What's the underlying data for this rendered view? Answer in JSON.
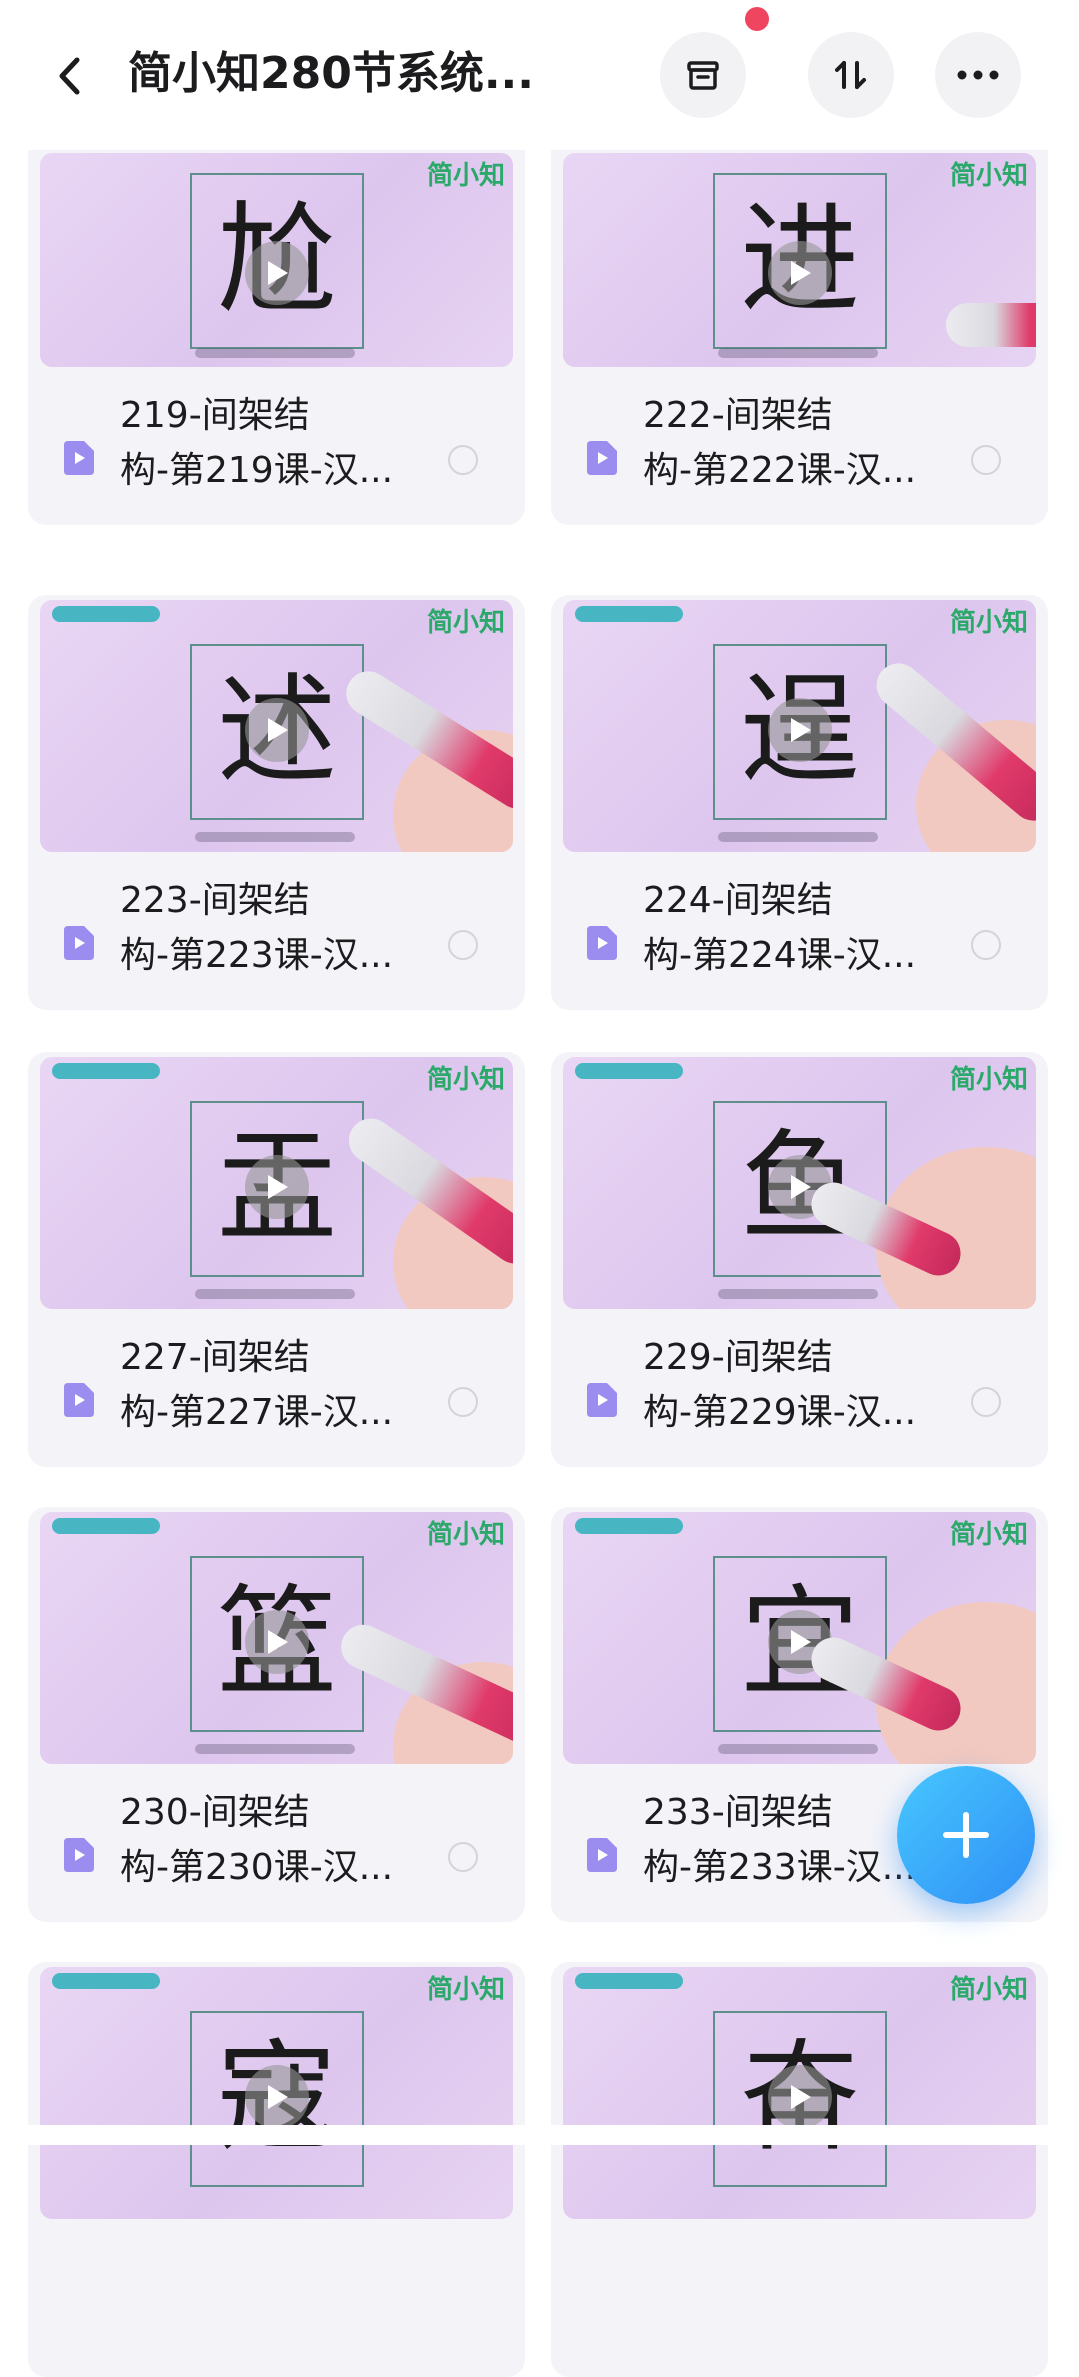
{
  "header": {
    "title": "简小知280节系统...",
    "back_icon": "chevron-left-icon",
    "actions": [
      {
        "name": "archive-icon"
      },
      {
        "name": "sort-icon"
      },
      {
        "name": "more-icon"
      }
    ],
    "notification_dot_color": "#f04560"
  },
  "thumb_common": {
    "logo_text": "简小知"
  },
  "cards": [
    {
      "title_line1": "219-间架结",
      "title_line2": "构-第219课-汉...",
      "char": "尬"
    },
    {
      "title_line1": "222-间架结",
      "title_line2": "构-第222课-汉...",
      "char": "进"
    },
    {
      "title_line1": "223-间架结",
      "title_line2": "构-第223课-汉...",
      "char": "述"
    },
    {
      "title_line1": "224-间架结",
      "title_line2": "构-第224课-汉...",
      "char": "逞"
    },
    {
      "title_line1": "227-间架结",
      "title_line2": "构-第227课-汉...",
      "char": "盂"
    },
    {
      "title_line1": "229-间架结",
      "title_line2": "构-第229课-汉...",
      "char": "鱼"
    },
    {
      "title_line1": "230-间架结",
      "title_line2": "构-第230课-汉...",
      "char": "篮"
    },
    {
      "title_line1": "233-间架结",
      "title_line2": "构-第233课-汉...",
      "char": "宜"
    },
    {
      "title_line1": "",
      "title_line2": "",
      "char": "寇"
    },
    {
      "title_line1": "",
      "title_line2": "",
      "char": "奋"
    }
  ],
  "colors": {
    "accent": "#2f8ff5",
    "file_icon": "#9b8cf0",
    "card_bg": "#f4f4f8"
  },
  "fab": {
    "icon": "plus-icon"
  }
}
